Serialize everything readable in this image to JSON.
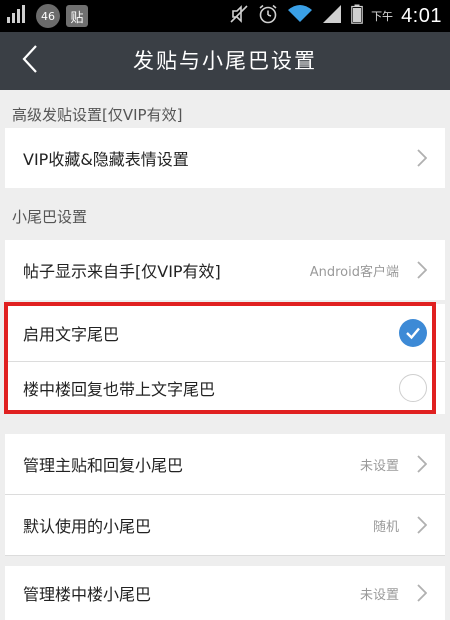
{
  "status_bar": {
    "badge_circle": "46",
    "badge_square": "贴",
    "ampm": "下午",
    "time": "4:01"
  },
  "header": {
    "title": "发贴与小尾巴设置"
  },
  "sections": {
    "advanced_label": "高级发贴设置[仅VIP有效]",
    "tail_label": "小尾巴设置"
  },
  "rows": {
    "vip_favorites": {
      "label": "VIP收藏&隐藏表情设置"
    },
    "post_source": {
      "label": "帖子显示来自手[仅VIP有效]",
      "value": "Android客户端"
    },
    "enable_text_tail": {
      "label": "启用文字尾巴",
      "checked": true
    },
    "floor_reply_tail": {
      "label": "楼中楼回复也带上文字尾巴",
      "checked": false
    },
    "manage_main_tail": {
      "label": "管理主贴和回复小尾巴",
      "value": "未设置"
    },
    "default_tail": {
      "label": "默认使用的小尾巴",
      "value": "随机"
    },
    "manage_floor_tail": {
      "label": "管理楼中楼小尾巴",
      "value": "未设置"
    }
  },
  "colors": {
    "accent": "#3d8ad6",
    "highlight": "#e02020",
    "header_bg": "#3a3f45"
  }
}
